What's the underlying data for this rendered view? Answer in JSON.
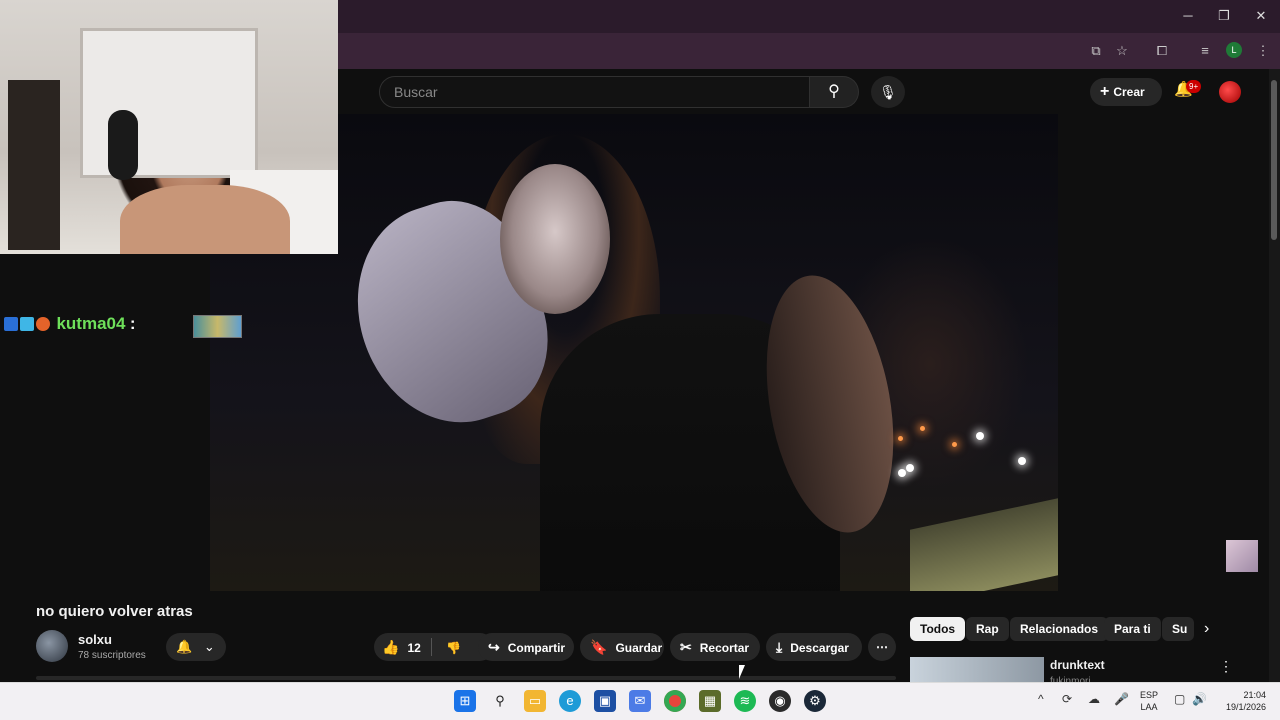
{
  "window": {
    "minimize_label": "─",
    "restore_label": "❐",
    "close_label": "✕",
    "profile_initial": "L"
  },
  "toolbar_icons": [
    "cast-icon",
    "star-icon",
    "extensions-icon",
    "media-icon",
    "profile-icon",
    "kebab-icon"
  ],
  "header": {
    "search_placeholder": "Buscar",
    "create_label": "Crear",
    "notifications_badge": "9+"
  },
  "overlay": {
    "chat_user": "kutma04",
    "chat_colon": ":"
  },
  "video": {
    "title": "no quiero volver atras",
    "channel": "solxu",
    "subscribers": "78 suscriptores"
  },
  "actions": {
    "likes": "12",
    "share": "Compartir",
    "save": "Guardar",
    "clip": "Recortar",
    "download": "Descargar"
  },
  "chips": [
    "Todos",
    "Rap",
    "Relacionados",
    "Para ti",
    "Su"
  ],
  "recommendation": {
    "title": "drunktext",
    "channel": "fukinmori"
  },
  "taskbar": {
    "lang_line1": "ESP",
    "lang_line2": "LAA",
    "time": "21:04",
    "date": "19/1/2026"
  },
  "colors": {
    "chat_user": "#6ee05a",
    "notification_red": "#cc0000",
    "browser_frame": "#2b1b2b"
  }
}
